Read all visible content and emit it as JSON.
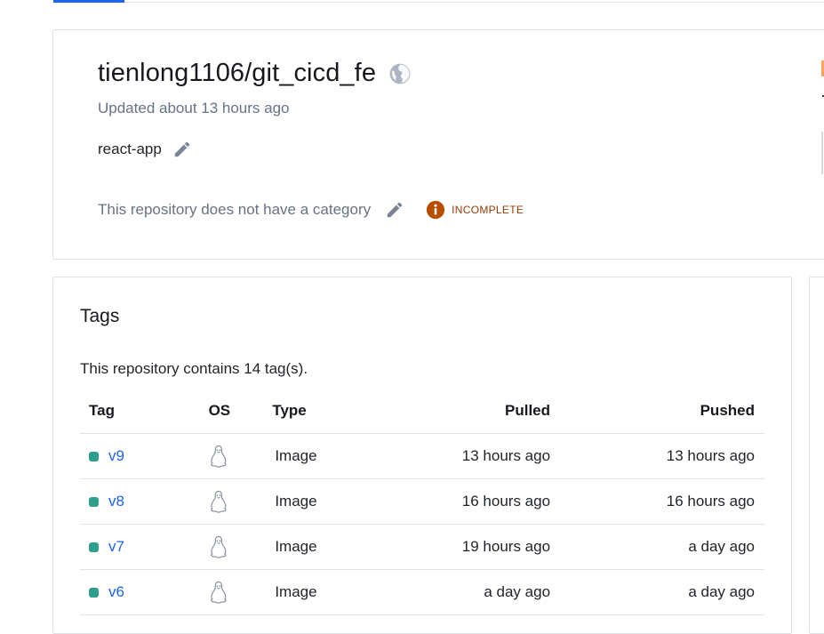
{
  "repo": {
    "title": "tienlong1106/git_cicd_fe",
    "updated": "Updated about 13 hours ago",
    "description": "react-app",
    "category_text": "This repository does not have a category",
    "status_label": "INCOMPLETE",
    "visibility_icon": "globe-icon",
    "colors": {
      "accent": "#1d63ed",
      "incomplete": "#b84d00",
      "tag_dot": "#2e9f8c"
    }
  },
  "tags": {
    "title": "Tags",
    "summary": "This repository contains 14 tag(s).",
    "headers": {
      "tag": "Tag",
      "os": "OS",
      "type": "Type",
      "pulled": "Pulled",
      "pushed": "Pushed"
    },
    "rows": [
      {
        "tag": "v9",
        "os_icon": "linux-icon",
        "type": "Image",
        "pulled": "13 hours ago",
        "pushed": "13 hours ago"
      },
      {
        "tag": "v8",
        "os_icon": "linux-icon",
        "type": "Image",
        "pulled": "16 hours ago",
        "pushed": "16 hours ago"
      },
      {
        "tag": "v7",
        "os_icon": "linux-icon",
        "type": "Image",
        "pulled": "19 hours ago",
        "pushed": "a day ago"
      },
      {
        "tag": "v6",
        "os_icon": "linux-icon",
        "type": "Image",
        "pulled": "a day ago",
        "pushed": "a day ago"
      }
    ]
  }
}
